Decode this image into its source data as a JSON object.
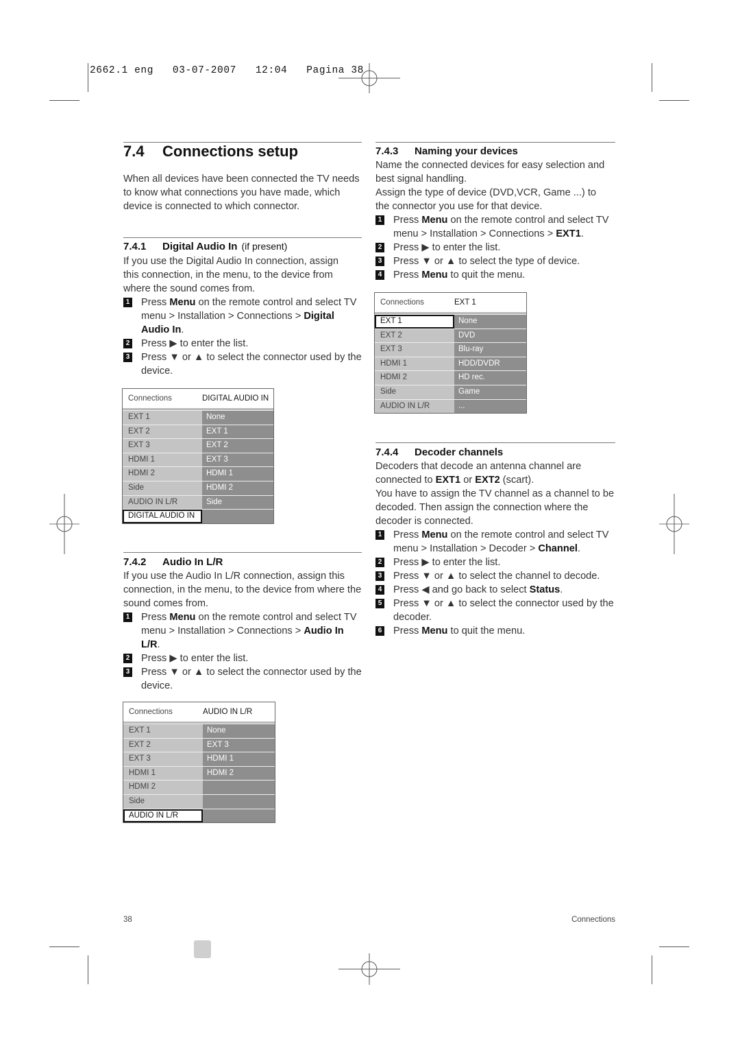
{
  "print_slug": "2662.1 eng   03-07-2007   12:04   Pagina 38",
  "section": {
    "number": "7.4",
    "title": "Connections setup",
    "intro": "When all devices have been connected the TV needs to know what connections you have made, which device is connected to which connector."
  },
  "subsections": [
    {
      "number": "7.4.1",
      "title": "Digital Audio In",
      "note": "(if present)",
      "body": "If you use the Digital Audio In connection, assign this connection, in the menu, to the device from where the sound comes from.",
      "steps": [
        {
          "n": "1",
          "pre": "Press ",
          "bold1": "Menu",
          "mid": " on the remote control and select TV menu > Installation > Connections > ",
          "bold2": "Digital Audio In",
          "post": "."
        },
        {
          "n": "2",
          "text": "Press ▶ to enter the list."
        },
        {
          "n": "3",
          "text": "Press ▼ or ▲ to select the connector used by the device."
        }
      ],
      "menu": {
        "header_left": "Connections",
        "header_right": "DIGITAL AUDIO IN",
        "left_items": [
          "EXT 1",
          "EXT 2",
          "EXT 3",
          "HDMI 1",
          "HDMI 2",
          "Side",
          "AUDIO IN L/R",
          "DIGITAL AUDIO IN"
        ],
        "right_items": [
          "None",
          "EXT 1",
          "EXT 2",
          "EXT 3",
          "HDMI 1",
          "HDMI 2",
          "Side",
          ""
        ],
        "selected_index": 7
      }
    },
    {
      "number": "7.4.2",
      "title": "Audio In L/R",
      "body": "If you use the Audio In L/R connection, assign this connection, in the menu, to the device from where the sound comes from.",
      "steps": [
        {
          "n": "1",
          "pre": "Press ",
          "bold1": "Menu",
          "mid": " on the remote control and select TV menu > Installation > Connections > ",
          "bold2": "Audio In L/R",
          "post": "."
        },
        {
          "n": "2",
          "text": "Press ▶ to enter the list."
        },
        {
          "n": "3",
          "text": "Press ▼ or ▲ to select the connector used by the device."
        }
      ],
      "menu": {
        "header_left": "Connections",
        "header_right": "AUDIO IN L/R",
        "left_items": [
          "EXT 1",
          "EXT 2",
          "EXT 3",
          "HDMI 1",
          "HDMI 2",
          "Side",
          "AUDIO IN L/R"
        ],
        "right_items": [
          "None",
          "EXT 3",
          "HDMI 1",
          "HDMI 2",
          "",
          "",
          ""
        ],
        "selected_index": 6
      }
    },
    {
      "number": "7.4.3",
      "title": "Naming your devices",
      "body": "Name the connected devices for easy selection and best signal handling.",
      "body2": "Assign the type of device (DVD,VCR, Game ...) to the connector you use for that device.",
      "steps": [
        {
          "n": "1",
          "pre": "Press ",
          "bold1": "Menu",
          "mid": " on the remote control and select TV menu > Installation > Connections > ",
          "bold2": "EXT1",
          "post": "."
        },
        {
          "n": "2",
          "text": "Press ▶ to enter the list."
        },
        {
          "n": "3",
          "text": "Press ▼ or ▲ to select the type of device."
        },
        {
          "n": "4",
          "pre": "Press ",
          "bold1": "Menu",
          "mid": " to quit the menu.",
          "bold2": "",
          "post": ""
        }
      ],
      "menu": {
        "header_left": "Connections",
        "header_right": "EXT 1",
        "left_items": [
          "EXT 1",
          "EXT 2",
          "EXT 3",
          "HDMI 1",
          "HDMI 2",
          "Side",
          "AUDIO IN L/R"
        ],
        "right_items": [
          "None",
          "DVD",
          "Blu-ray",
          "HDD/DVDR",
          "HD rec.",
          "Game",
          "..."
        ],
        "selected_index": 0
      }
    },
    {
      "number": "7.4.4",
      "title": "Decoder channels",
      "body_pre": "Decoders that decode an antenna channel are connected to ",
      "body_b1": "EXT1",
      "body_mid": " or ",
      "body_b2": "EXT2",
      "body_post": " (scart).",
      "body2": "You have to assign the TV channel as a channel to be decoded. Then assign the connection where the decoder is connected.",
      "steps": [
        {
          "n": "1",
          "pre": "Press ",
          "bold1": "Menu",
          "mid": " on the remote control and select TV menu > Installation > Decoder > ",
          "bold2": "Channel",
          "post": "."
        },
        {
          "n": "2",
          "text": "Press ▶ to enter the list."
        },
        {
          "n": "3",
          "text": "Press ▼ or ▲ to select the channel to decode."
        },
        {
          "n": "4",
          "pre": "Press ◀ and go back to select ",
          "bold1": "Status",
          "mid": ".",
          "bold2": "",
          "post": ""
        },
        {
          "n": "5",
          "text": "Press ▼ or ▲ to select the connector used by the decoder."
        },
        {
          "n": "6",
          "pre": "Press ",
          "bold1": "Menu",
          "mid": " to quit the menu.",
          "bold2": "",
          "post": ""
        }
      ]
    }
  ],
  "footer": {
    "page_number": "38",
    "section_name": "Connections"
  }
}
